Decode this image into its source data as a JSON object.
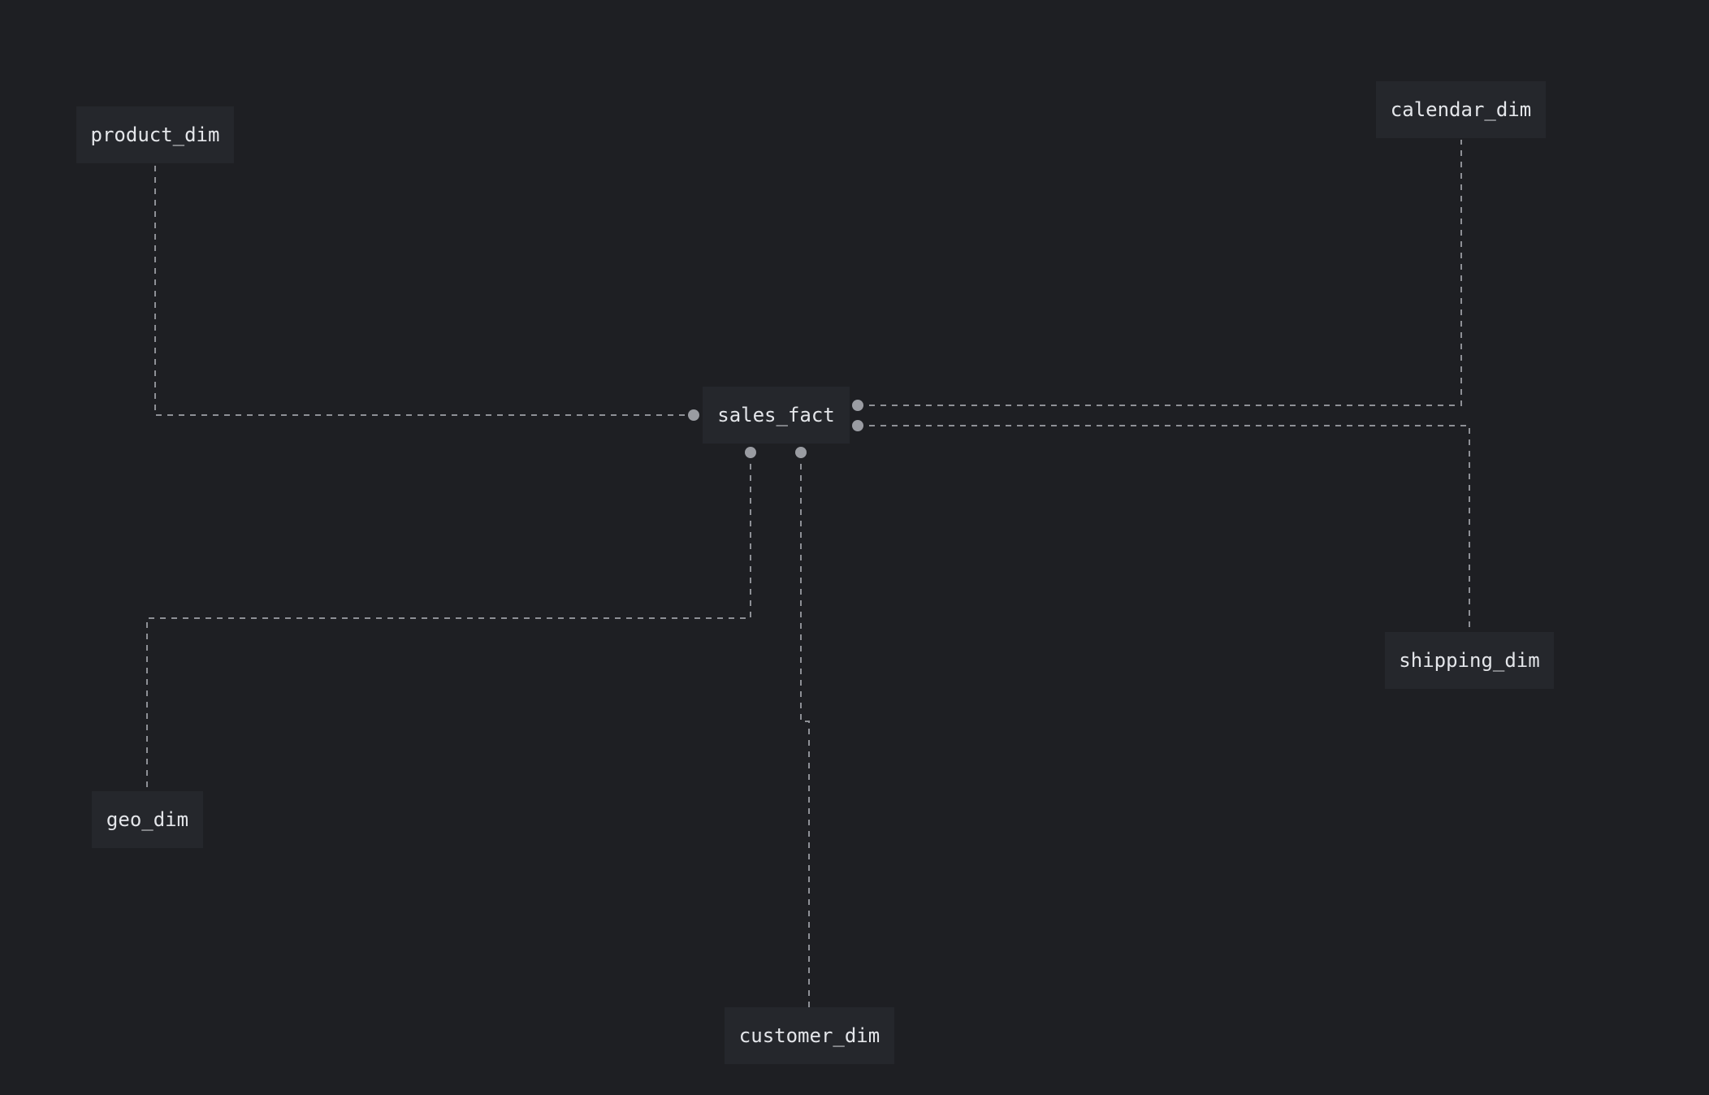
{
  "diagram": {
    "nodes": {
      "product_dim": "product_dim",
      "calendar_dim": "calendar_dim",
      "sales_fact": "sales_fact",
      "shipping_dim": "shipping_dim",
      "geo_dim": "geo_dim",
      "customer_dim": "customer_dim"
    },
    "edges": [
      {
        "from": "sales_fact",
        "to": "product_dim"
      },
      {
        "from": "sales_fact",
        "to": "calendar_dim"
      },
      {
        "from": "sales_fact",
        "to": "shipping_dim"
      },
      {
        "from": "sales_fact",
        "to": "geo_dim"
      },
      {
        "from": "sales_fact",
        "to": "customer_dim"
      }
    ]
  },
  "colors": {
    "background": "#1e1f23",
    "node_fill": "#25272c",
    "node_text": "#e4e6ea",
    "edge": "#8e9096",
    "endpoint": "#9a9ca2"
  }
}
